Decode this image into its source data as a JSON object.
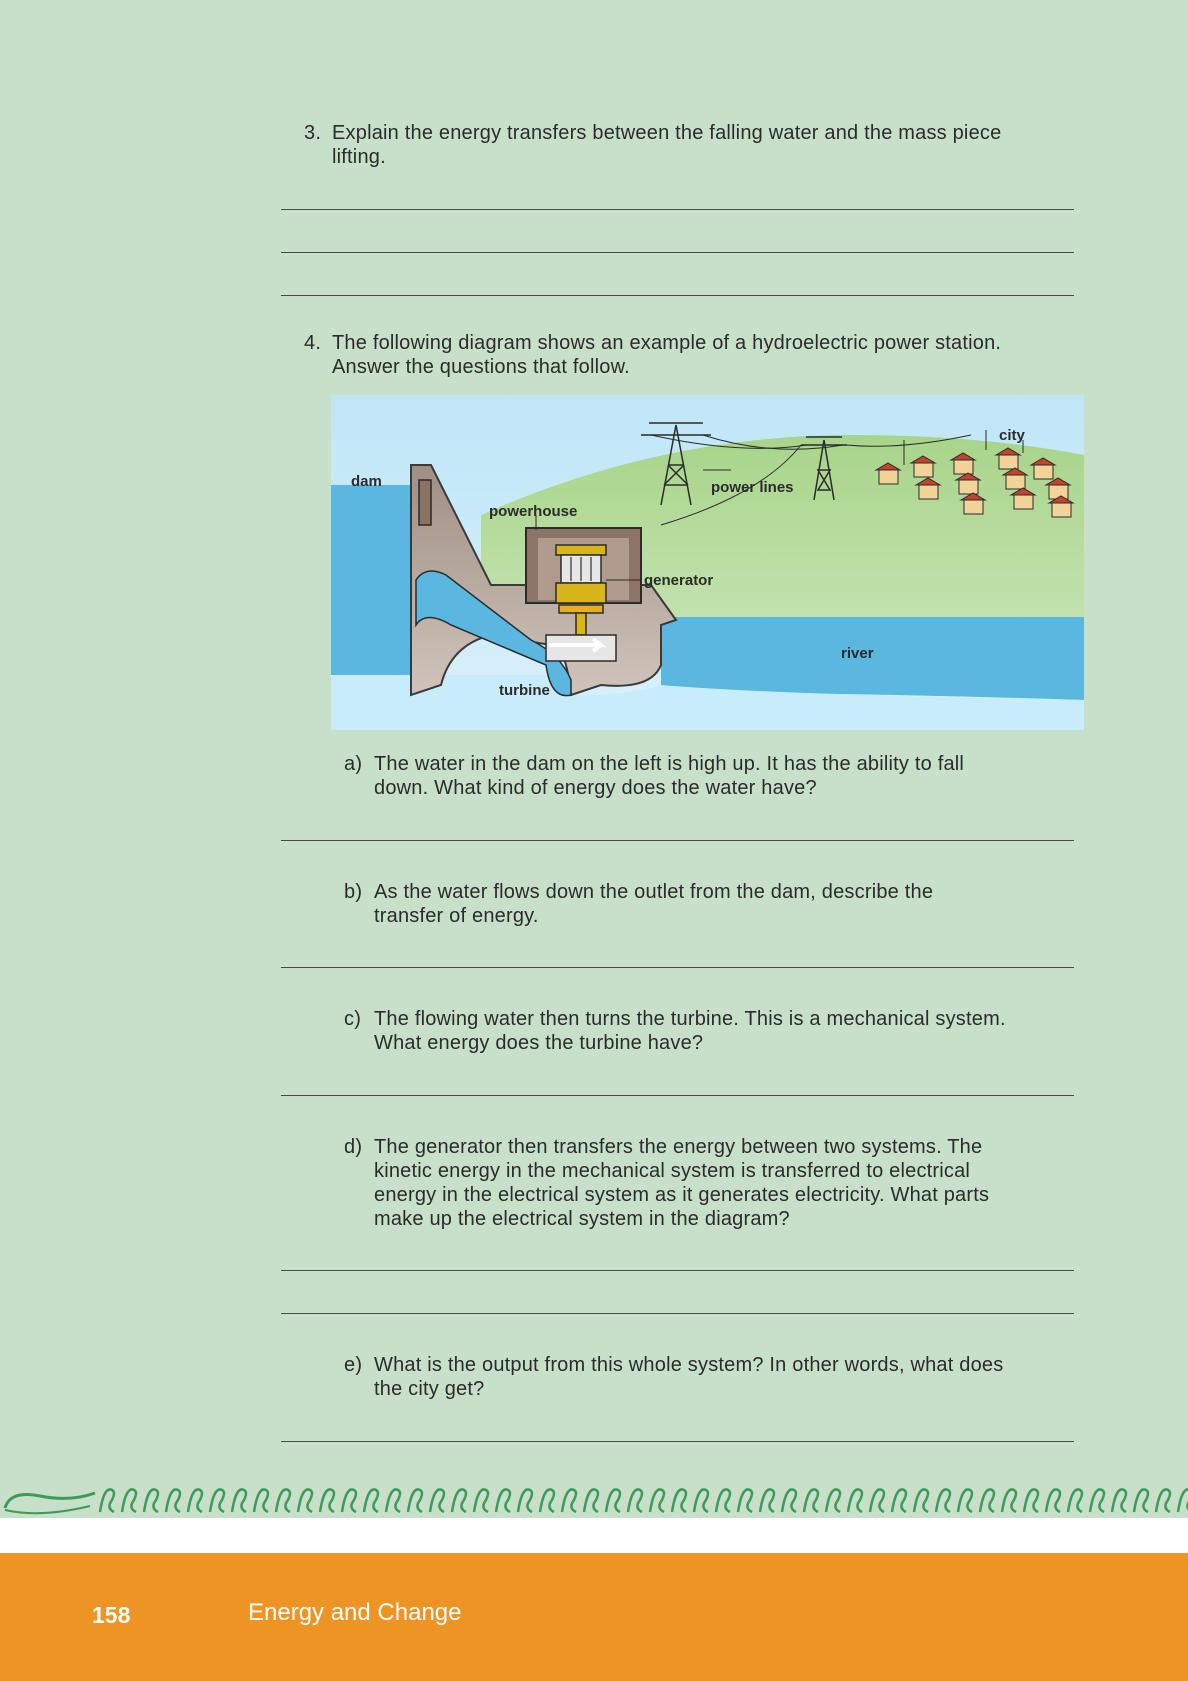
{
  "questions": {
    "q3": {
      "number": "3.",
      "text_line1": "Explain the energy transfers between the falling water and the mass piece",
      "text_line2": "lifting."
    },
    "q4": {
      "number": "4.",
      "text_line1": "The following diagram shows an example of a hydroelectric power station.",
      "text_line2": "Answer the questions that follow.",
      "diagram_labels": {
        "dam": "dam",
        "powerhouse": "powerhouse",
        "power_lines": "power lines",
        "city": "city",
        "generator": "generator",
        "river": "river",
        "turbine": "turbine"
      },
      "sub": [
        {
          "letter": "a)",
          "lines": [
            "The water in the dam on the left is high up. It has the ability to fall",
            "down. What kind of energy does the water have?"
          ]
        },
        {
          "letter": "b)",
          "lines": [
            "As the water flows down the outlet from the dam, describe the",
            "transfer of energy."
          ]
        },
        {
          "letter": "c)",
          "lines": [
            "The flowing water then turns the turbine. This is a mechanical system.",
            "What energy does the turbine have?"
          ]
        },
        {
          "letter": "d)",
          "lines": [
            "The generator then transfers the energy between two systems. The",
            "kinetic energy in the mechanical system is transferred to electrical",
            "energy in the electrical system as it generates electricity. What parts",
            "make up the electrical system in the diagram?"
          ]
        },
        {
          "letter": "e)",
          "lines": [
            "What is the output from this whole system? In other words, what does",
            "the city get?"
          ]
        }
      ]
    }
  },
  "footer": {
    "page_number": "158",
    "title": "Energy and Change"
  },
  "colors": {
    "background": "#c8e0ca",
    "footer": "#ee9424",
    "border_pattern": "#3d9a5a"
  }
}
